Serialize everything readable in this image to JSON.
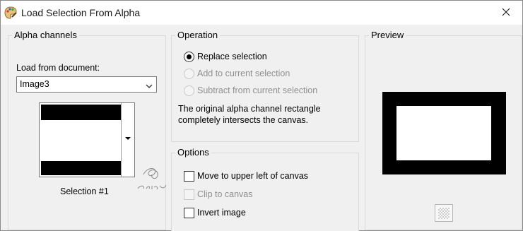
{
  "window": {
    "title": "Load Selection From Alpha"
  },
  "alpha_channels": {
    "title": "Alpha channels",
    "load_label": "Load from document:",
    "document_value": "Image3",
    "selection_label": "Selection #1"
  },
  "operation": {
    "title": "Operation",
    "options": [
      {
        "label": "Replace selection",
        "checked": true,
        "enabled": true
      },
      {
        "label": "Add to current selection",
        "checked": false,
        "enabled": false
      },
      {
        "label": "Subtract from current selection",
        "checked": false,
        "enabled": false
      }
    ],
    "message_line1": "The original alpha channel rectangle",
    "message_line2": "completely intersects the canvas."
  },
  "options": {
    "title": "Options",
    "items": [
      {
        "label": "Move to upper left of canvas",
        "checked": false,
        "enabled": true
      },
      {
        "label": "Clip to canvas",
        "checked": false,
        "enabled": false
      },
      {
        "label": "Invert image",
        "checked": false,
        "enabled": true
      }
    ]
  },
  "preview": {
    "title": "Preview"
  },
  "colors": {
    "dialog_bg": "#f0f0f0",
    "titlebar_bg": "#ffffff",
    "disabled_text": "#8f8f8f",
    "mask_black": "#000000"
  },
  "icons": {
    "app": "paint-palette-icon",
    "close": "close-icon",
    "dropdown": "chevron-down-icon",
    "checker": "checkerboard-icon"
  }
}
